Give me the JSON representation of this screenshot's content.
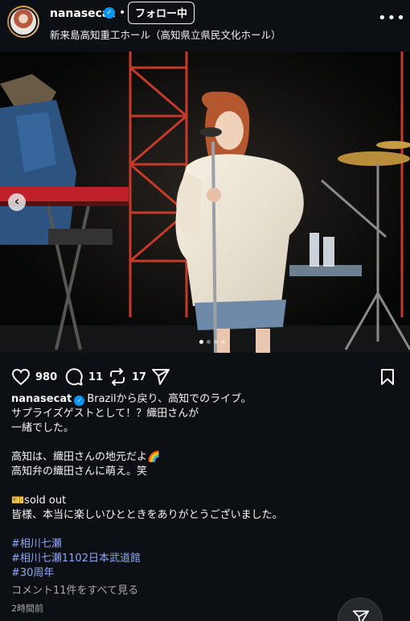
{
  "post": {
    "username": "nanasecat",
    "separator": "•",
    "follow_label": "フォロー中",
    "location": "新来島高知重工ホール（高知県立県民文化ホール）",
    "more_label": "•••"
  },
  "carousel": {
    "prev_label": "‹",
    "slide_count": 4,
    "active_slide": 1
  },
  "actions": {
    "likes": "980",
    "comments": "11",
    "reposts": "17"
  },
  "caption": {
    "username": "nanasecat",
    "line1": "Brazilから戻り、高知でのライブ。",
    "line2": "サプライズゲストとして！？織田さんが",
    "line3": "一緒でした。",
    "line4": "高知は、織田さんの地元だよ🌈",
    "line5": "高知弁の織田さんに萌え。笑",
    "line6": "🎫sold out",
    "line7": "皆様、本当に楽しいひとときをありがとうございました。",
    "tags": [
      "#相川七瀬",
      "#相川七瀬1102日本武道館",
      "#30周年"
    ],
    "view_comments": "コメント11件をすべて見る",
    "time": "2時間前"
  },
  "colors": {
    "background": "#0c1014",
    "verified": "#0095f6",
    "hashtag": "#8ea6f6",
    "muted": "#a8a8a8"
  },
  "icons": {
    "like": "heart-icon",
    "comment": "comment-icon",
    "repost": "repost-icon",
    "share": "send-icon",
    "save": "bookmark-icon",
    "message": "message-icon"
  }
}
